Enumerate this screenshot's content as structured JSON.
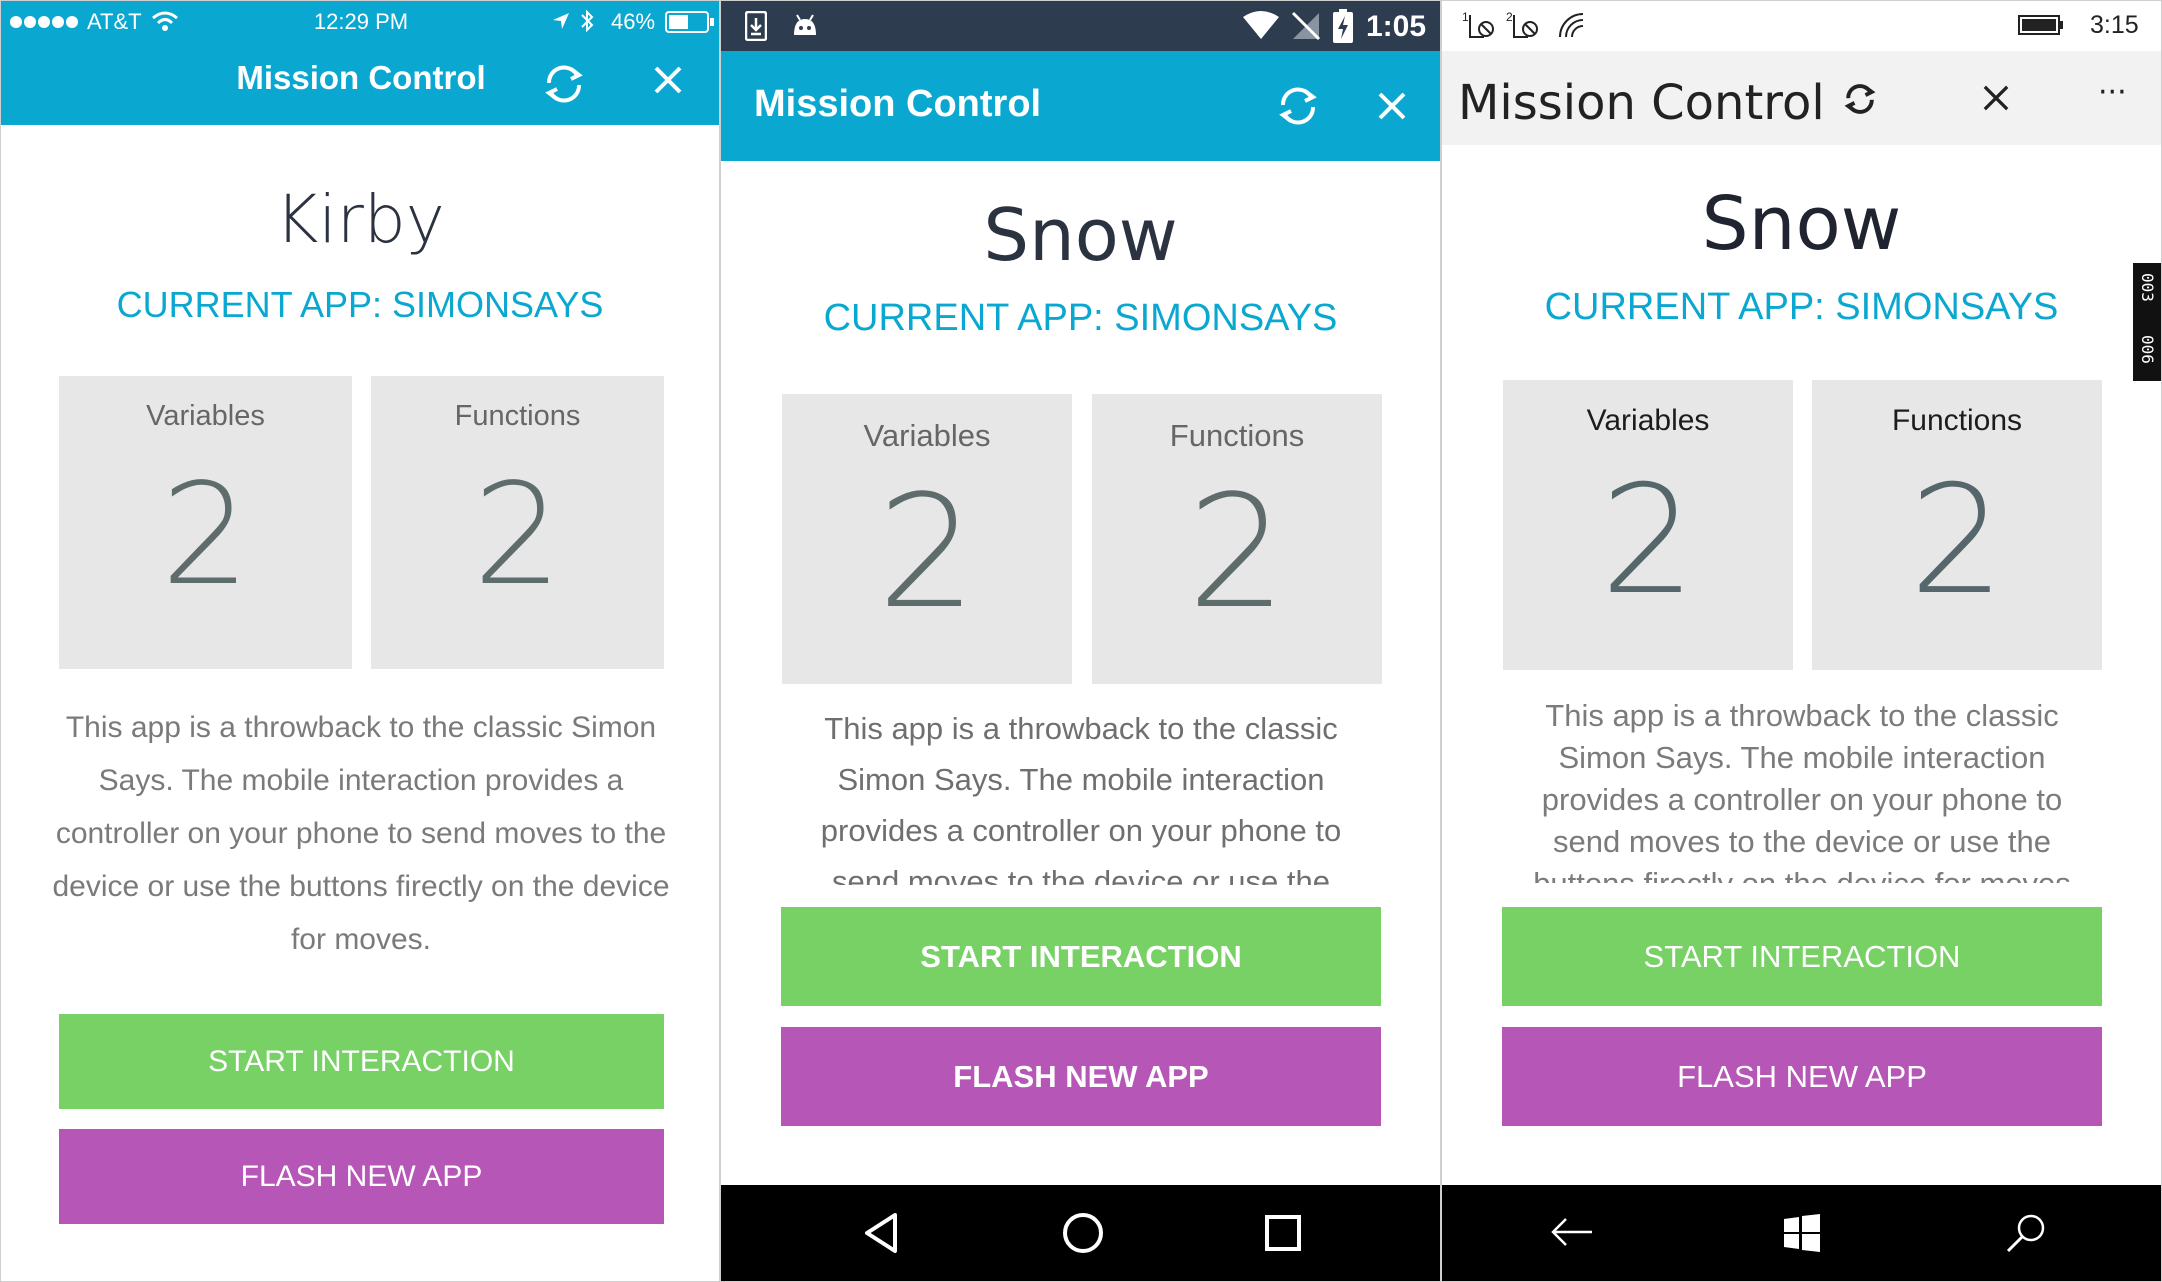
{
  "ios": {
    "status": {
      "carrier": "AT&T",
      "time": "12:29 PM",
      "battery": "46%"
    },
    "title": "Mission Control",
    "device_name": "Kirby",
    "current_app": "CURRENT APP: SIMONSAYS",
    "tiles": [
      {
        "label": "Variables",
        "value": "2"
      },
      {
        "label": "Functions",
        "value": "2"
      }
    ],
    "description": "This app is a throwback to the classic Simon Says. The mobile interaction provides a controller on your phone to send moves to the device or use the buttons firectly on the device for moves.",
    "start_label": "START INTERACTION",
    "flash_label": "FLASH NEW APP"
  },
  "android": {
    "status": {
      "time": "1:05"
    },
    "title": "Mission Control",
    "device_name": "Snow",
    "current_app": "CURRENT APP: SIMONSAYS",
    "tiles": [
      {
        "label": "Variables",
        "value": "2"
      },
      {
        "label": "Functions",
        "value": "2"
      }
    ],
    "description": "This app is a throwback to the classic Simon Says. The mobile interaction provides a controller on your phone to send moves to the device or use the",
    "start_label": "START INTERACTION",
    "flash_label": "FLASH NEW APP"
  },
  "windows": {
    "status": {
      "time": "3:15",
      "side_tab": [
        "003",
        "006"
      ]
    },
    "title": "Mission Control",
    "more_label": "···",
    "device_name": "Snow",
    "current_app": "CURRENT APP: SIMONSAYS",
    "tiles": [
      {
        "label": "Variables",
        "value": "2"
      },
      {
        "label": "Functions",
        "value": "2"
      }
    ],
    "description": "This app is a throwback to the classic Simon Says. The mobile interaction provides a controller on your phone to send moves to the device or use the buttons firectly on the device for moves",
    "start_label": "START INTERACTION",
    "flash_label": "FLASH NEW APP"
  },
  "icons": {
    "refresh": "refresh-icon",
    "close": "close-icon",
    "back": "back-icon",
    "home": "home-icon",
    "recents": "recents-icon",
    "search": "search-icon",
    "windows_logo": "windows-logo-icon"
  },
  "colors": {
    "accent": "#0aa8d1",
    "start_button": "#77d165",
    "flash_button": "#b656b6",
    "tile": "#e7e7e7",
    "android_status": "#2e3c4f"
  }
}
